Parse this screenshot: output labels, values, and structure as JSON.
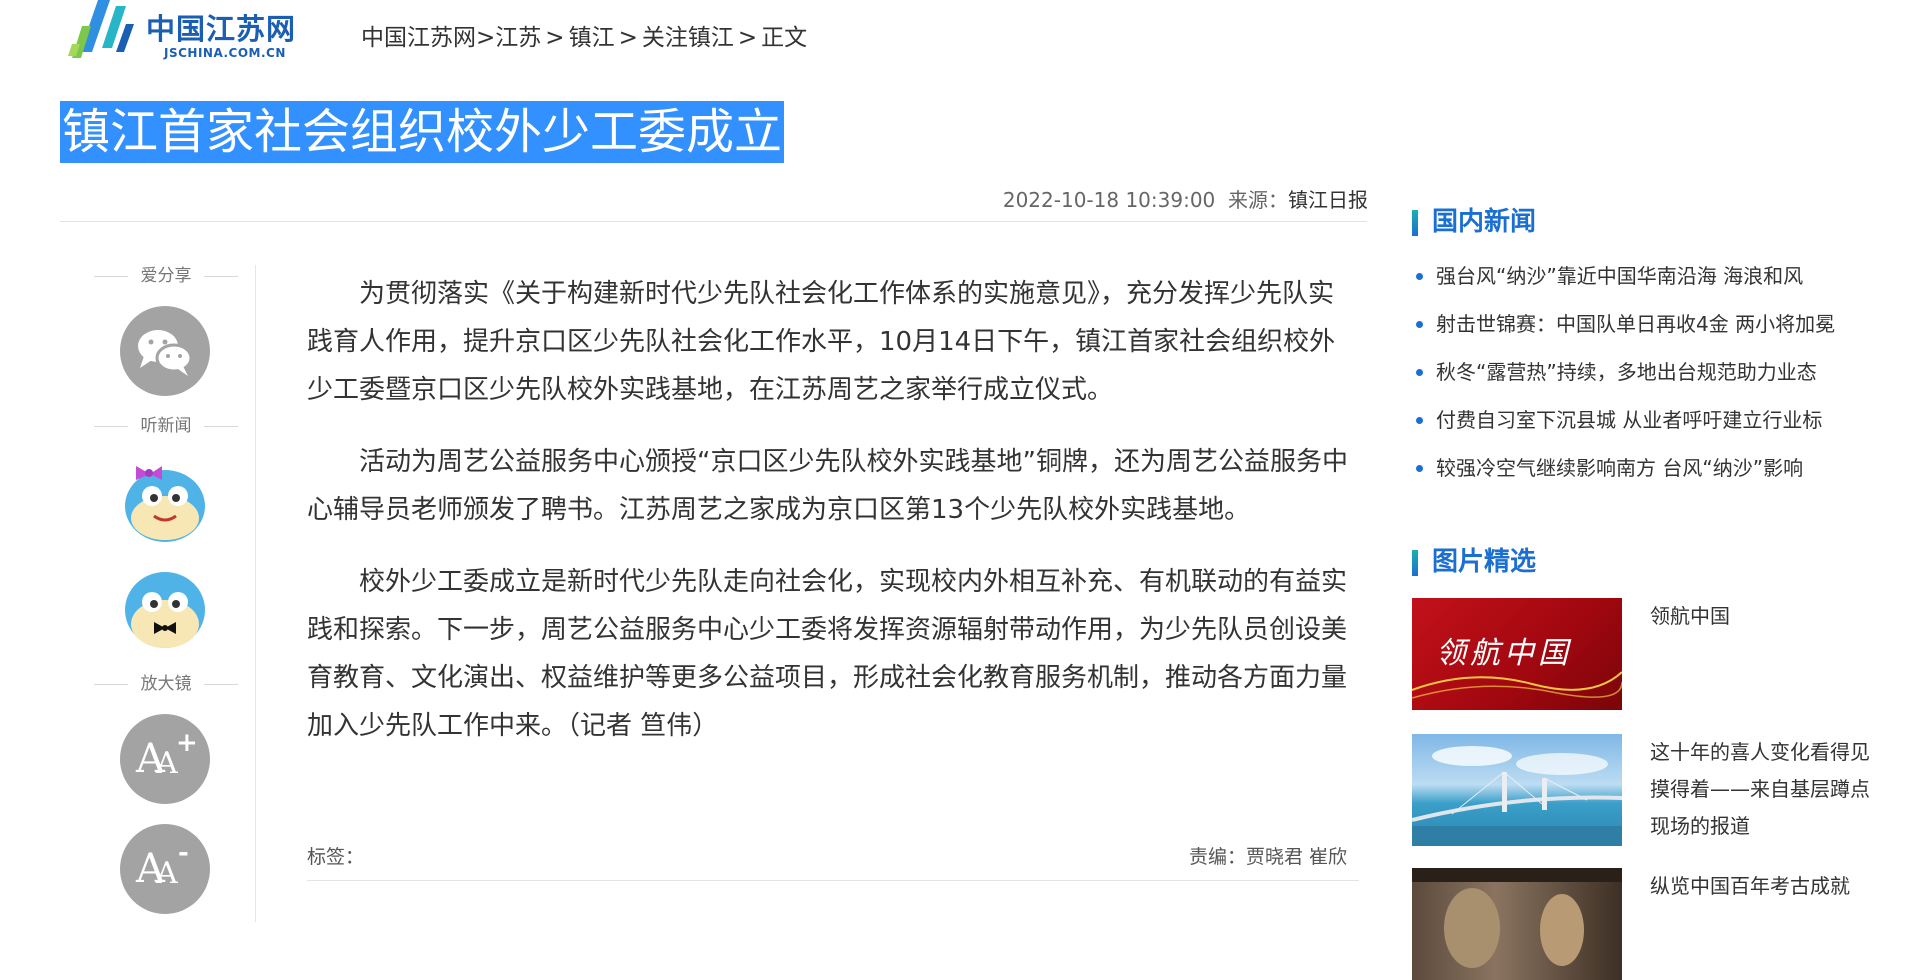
{
  "header": {
    "logo_text": "中国江苏网",
    "logo_sub": "JSCHINA.COM.CN",
    "breadcrumb": [
      "中国江苏网>江苏",
      "镇江",
      "关注镇江",
      "正文"
    ]
  },
  "article": {
    "title": "镇江首家社会组织校外少工委成立",
    "datetime": "2022-10-18 10:39:00",
    "source_label": "来源：",
    "source_value": "镇江日报",
    "paragraphs": [
      "为贯彻落实《关于构建新时代少先队社会化工作体系的实施意见》，充分发挥少先队实践育人作用，提升京口区少先队社会化工作水平，10月14日下午，镇江首家社会组织校外少工委暨京口区少先队校外实践基地，在江苏周艺之家举行成立仪式。",
      "活动为周艺公益服务中心颁授“京口区少先队校外实践基地”铜牌，还为周艺公益服务中心辅导员老师颁发了聘书。江苏周艺之家成为京口区第13个少先队校外实践基地。",
      "校外少工委成立是新时代少先队走向社会化，实现校内外相互补充、有机联动的有益实践和探索。下一步，周艺公益服务中心少工委将发挥资源辐射带动作用，为少先队员创设美育教育、文化演出、权益维护等更多公益项目，形成社会化教育服务机制，推动各方面力量加入少先队工作中来。（记者 笪伟）"
    ],
    "tags_label": "标签：",
    "editor_label": "责编：",
    "editor_value": "贾晓君 崔欣"
  },
  "share": {
    "share_label": "爱分享",
    "listen_label": "听新闻",
    "zoom_label": "放大镜",
    "zoom_in_text": "A",
    "zoom_out_text": "A"
  },
  "sidebar": {
    "domestic_title": "国内新闻",
    "domestic_items": [
      "强台风“纳沙”靠近中国华南沿海 海浪和风",
      "射击世锦赛：中国队单日再收4金 两小将加冕",
      "秋冬“露营热”持续，多地出台规范助力业态",
      "付费自习室下沉县城 从业者呼吁建立行业标",
      "较强冷空气继续影响南方 台风“纳沙”影响"
    ],
    "picture_title": "图片精选",
    "picture_items": [
      {
        "caption": "领航中国",
        "thumb_text": "领航中国"
      },
      {
        "caption": "这十年的喜人变化看得见摸得着——来自基层蹲点现场的报道"
      },
      {
        "caption": "纵览中国百年考古成就"
      }
    ]
  },
  "colors": {
    "highlight": "#3390ff",
    "brand_blue": "#1a5fb4",
    "sidebar_accent": "#1a6fd0",
    "icon_gray": "#a3a3a3"
  }
}
